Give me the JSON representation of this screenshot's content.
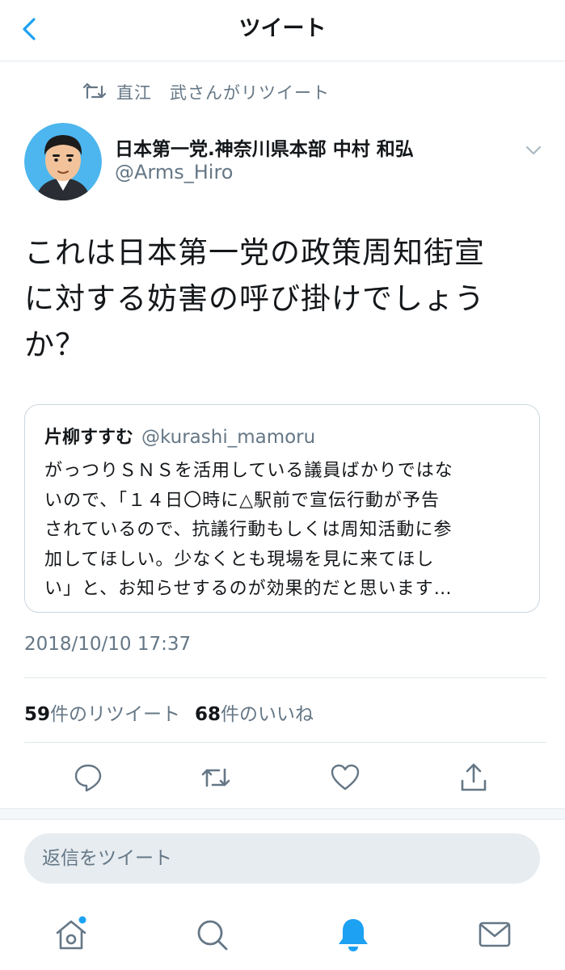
{
  "header": {
    "title": "ツイート",
    "back_icon": "chevron-left-icon"
  },
  "retweet": {
    "icon": "retweet-icon",
    "text": "直江　武さんがリツイート"
  },
  "author": {
    "name": "日本第一党.神奈川県本部 中村 和弘",
    "handle": "@Arms_Hiro",
    "avatar": "cartoon-avatar",
    "menu_icon": "chevron-down-icon"
  },
  "tweet": {
    "lines": [
      "これは日本第一党の政策周知街宣",
      "に対する妨害の呼び掛けでしょう",
      "か？"
    ]
  },
  "quote": {
    "name": "片柳すすむ",
    "handle": "@kurashi_mamoru",
    "lines": [
      "がっつりＳＮＳを活用している議員ばかりではな",
      "いので、「１４日〇時に△駅前で宣伝行動が予告",
      "されているので、抗議行動もしくは周知活動に参",
      "加してほしい。少なくとも現場を見に来てほし",
      "い」と、お知らせするのが効果的だと思います…"
    ]
  },
  "timestamp": "2018/10/10 17:37",
  "stats": {
    "retweets_count": "59",
    "retweets_label": "件のリツイート",
    "likes_count": "68",
    "likes_label": "件のいいね"
  },
  "actions": [
    "reply-icon",
    "retweet-icon",
    "like-icon",
    "share-icon"
  ],
  "reply": {
    "placeholder": "返信をツイート"
  },
  "tabbar": {
    "items": [
      "home-icon",
      "search-icon",
      "notifications-icon",
      "messages-icon"
    ],
    "active": "notifications-icon",
    "home_has_new": true
  },
  "colors": {
    "accent": "#1da1f2",
    "icon_gray": "#657786",
    "divider": "#e1e8ed"
  }
}
